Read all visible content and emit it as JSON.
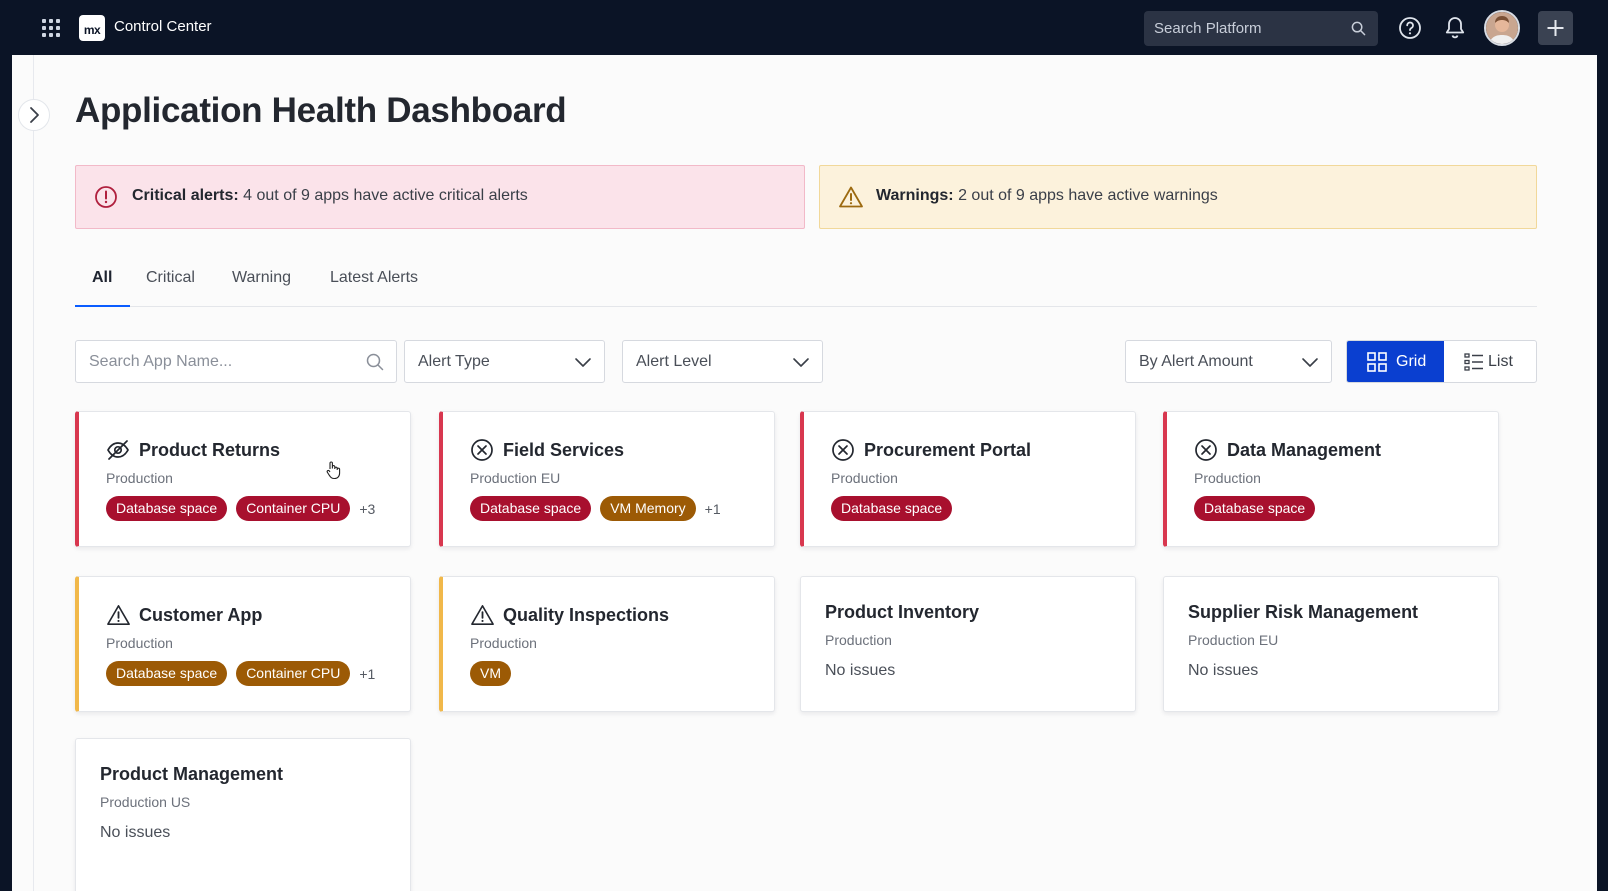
{
  "header": {
    "app_title": "Control Center",
    "logo_text": "mx",
    "search_placeholder": "Search Platform"
  },
  "page": {
    "title": "Application Health Dashboard"
  },
  "banners": {
    "critical": {
      "label": "Critical alerts:",
      "text": " 4 out of 9 apps have active critical alerts",
      "color": "#fbe3ea"
    },
    "warning": {
      "label": "Warnings:",
      "text": " 2 out of 9 apps have active warnings",
      "color": "#fcf2dc"
    }
  },
  "tabs": [
    {
      "label": "All",
      "active": true
    },
    {
      "label": "Critical",
      "active": false
    },
    {
      "label": "Warning",
      "active": false
    },
    {
      "label": "Latest Alerts",
      "active": false
    }
  ],
  "filters": {
    "search_placeholder": "Search App Name...",
    "alert_type": "Alert Type",
    "alert_level": "Alert Level",
    "sort": "By Alert Amount"
  },
  "view_toggle": {
    "grid": "Grid",
    "list": "List",
    "selected": "Grid",
    "accent": "#0a3fd0"
  },
  "colors": {
    "critical_accent": "#d8374f",
    "warning_accent": "#f1b84a",
    "critical_tag": "#a8102e",
    "warning_tag": "#9c5a05"
  },
  "apps": [
    {
      "name": "Product Returns",
      "env": "Production",
      "status": "critical",
      "icon": "eye-off-icon",
      "tags": [
        "Database space",
        "Container CPU"
      ],
      "more": "+3"
    },
    {
      "name": "Field Services",
      "env": "Production EU",
      "status": "critical",
      "icon": "x-circle-icon",
      "tags": [
        "Database space",
        "VM Memory"
      ],
      "more": "+1"
    },
    {
      "name": "Procurement Portal",
      "env": "Production",
      "status": "critical",
      "icon": "x-circle-icon",
      "tags": [
        "Database space"
      ]
    },
    {
      "name": "Data Management",
      "env": "Production",
      "status": "critical",
      "icon": "x-circle-icon",
      "tags": [
        "Database space"
      ]
    },
    {
      "name": "Customer App",
      "env": "Production",
      "status": "warning",
      "icon": "warning-triangle-icon",
      "tags": [
        "Database space",
        "Container CPU"
      ],
      "more": "+1"
    },
    {
      "name": "Quality Inspections",
      "env": "Production",
      "status": "warning",
      "icon": "warning-triangle-icon",
      "tags": [
        "VM"
      ]
    },
    {
      "name": "Product Inventory",
      "env": "Production",
      "status": "ok",
      "note": "No issues"
    },
    {
      "name": "Supplier Risk Management",
      "env": "Production EU",
      "status": "ok",
      "note": "No issues"
    },
    {
      "name": "Product Management",
      "env": "Production US",
      "status": "ok",
      "note": "No issues"
    }
  ]
}
